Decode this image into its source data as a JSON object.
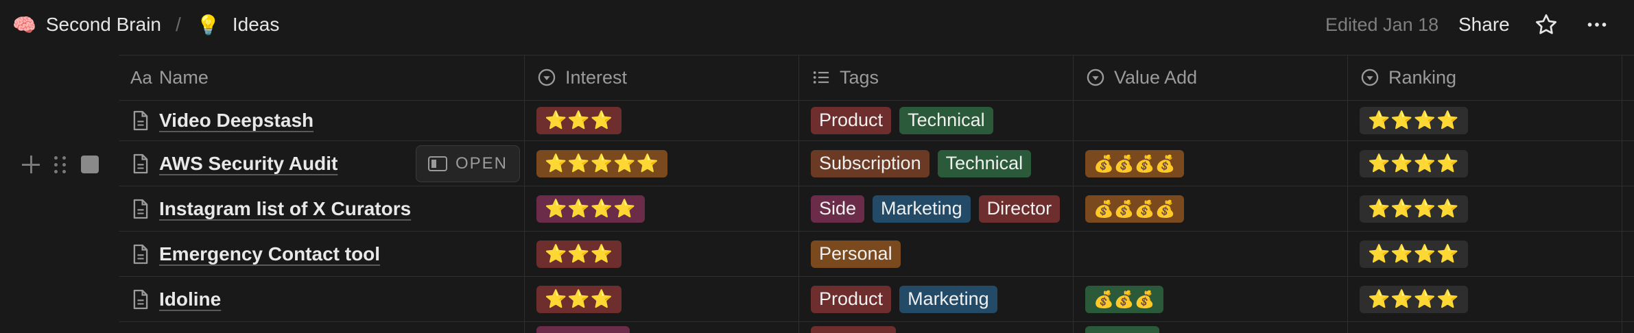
{
  "breadcrumb": {
    "workspace_icon": "🧠",
    "workspace": "Second Brain",
    "separator": "/",
    "page_icon": "💡",
    "page": "Ideas"
  },
  "topbar": {
    "edited": "Edited Jan 18",
    "share": "Share",
    "favorite_icon": "star-outline-icon",
    "more_icon": "more-horizontal-icon"
  },
  "columns": {
    "name": {
      "prefix": "Aa",
      "label": "Name"
    },
    "interest": {
      "icon": "select-icon",
      "label": "Interest"
    },
    "tags": {
      "icon": "multi-select-icon",
      "label": "Tags"
    },
    "value_add": {
      "icon": "select-icon",
      "label": "Value Add"
    },
    "ranking": {
      "icon": "select-icon",
      "label": "Ranking"
    }
  },
  "open_button": "OPEN",
  "tag_colors": {
    "Product": "#6e2e2e",
    "Technical": "#2b5a3a",
    "Subscription": "#6a3a24",
    "Side": "#6a2c48",
    "Marketing": "#234a66",
    "Director": "#6e2e2e",
    "Personal": "#7a4a1e"
  },
  "interest_colors": {
    "3": "#6e2e2e",
    "4": "#6a2c48",
    "5": "#7a4a1e"
  },
  "rows": [
    {
      "name": "Video Deepstash",
      "interest": "⭐⭐⭐",
      "tags": [
        "Product",
        "Technical"
      ],
      "value_add": "",
      "ranking": "⭐⭐⭐⭐"
    },
    {
      "name": "AWS Security Audit",
      "interest": "⭐⭐⭐⭐⭐",
      "tags": [
        "Subscription",
        "Technical"
      ],
      "value_add": "💰💰💰💰",
      "ranking": "⭐⭐⭐⭐"
    },
    {
      "name": "Instagram list of X Curators",
      "interest": "⭐⭐⭐⭐",
      "tags": [
        "Side",
        "Marketing",
        "Director"
      ],
      "value_add": "💰💰💰💰",
      "ranking": "⭐⭐⭐⭐"
    },
    {
      "name": "Emergency Contact tool",
      "interest": "⭐⭐⭐",
      "tags": [
        "Personal"
      ],
      "value_add": "",
      "ranking": "⭐⭐⭐⭐"
    },
    {
      "name": "Idoline",
      "interest": "⭐⭐⭐",
      "tags": [
        "Product",
        "Marketing"
      ],
      "value_add": "💰💰💰",
      "ranking": "⭐⭐⭐⭐"
    }
  ],
  "value_add_colors": {
    "4": "#7a4a1e",
    "3": "#2b5a3a"
  },
  "ranking_color": "#2e2e2e"
}
